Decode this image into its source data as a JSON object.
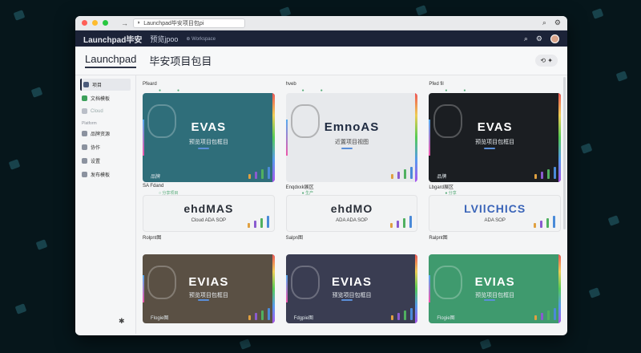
{
  "browser": {
    "url_text": "Launchpad毕安项目包pi",
    "traffic_colors": [
      "#ff5f57",
      "#febc2e",
      "#28c840"
    ]
  },
  "appbar": {
    "brand": "Launchpad毕安",
    "project": "预览jpoo",
    "workspace": "⊕ Workspace"
  },
  "header": {
    "brand": "Launchpad",
    "title": "毕安项目包目",
    "tools": "⟲ ✦"
  },
  "sidebar": {
    "items": [
      {
        "label": "项目",
        "icon": "home-icon",
        "active": true
      },
      {
        "label": "文档模板",
        "icon": "template-icon",
        "active": false
      },
      {
        "label": "Cloud",
        "icon": "cloud-icon",
        "active": false
      }
    ],
    "section_label": "Platform",
    "items2": [
      {
        "label": "品牌资源",
        "icon": "tag-icon"
      },
      {
        "label": "协作",
        "icon": "users-icon"
      },
      {
        "label": "设置",
        "icon": "shield-icon"
      },
      {
        "label": "发布模板",
        "icon": "tray-icon"
      }
    ]
  },
  "cards": [
    {
      "head": "Pfeard",
      "sub_a": "●",
      "sub_b": "●",
      "logo": "EVAS",
      "tagline": "预览项目包框目",
      "foot": "品牌",
      "theme": "teal"
    },
    {
      "head": "hveb",
      "sub_a": "●",
      "sub_b": "●",
      "logo": "EmnoAS",
      "tagline": "近置项目视图",
      "foot": "",
      "theme": "light"
    },
    {
      "head": "Pfed fil",
      "sub_a": "●",
      "sub_b": "●",
      "logo": "EVAS",
      "tagline": "预览项目包框目",
      "foot": "品牌",
      "theme": "dark"
    },
    {
      "head": "SA Fdand",
      "sub_a": "○ 分享项目",
      "sub_b": "",
      "logo": "ehdMAS",
      "tagline": "Cloud ADA SOP",
      "foot": "Rolpnt图",
      "theme": "short1"
    },
    {
      "head": "Enqdxxk展区",
      "sub_a": "● 生产",
      "sub_b": "",
      "logo": "ehdMO",
      "tagline": "ADA ADA SOP",
      "foot": "Salpn图",
      "theme": "short2"
    },
    {
      "head": "Lbgard展区",
      "sub_a": "● 分享",
      "sub_b": "",
      "logo": "LVIlCHICS",
      "tagline": "ADA SOP",
      "foot": "Ralpnt图",
      "theme": "short3"
    },
    {
      "head": "",
      "sub_a": "",
      "sub_b": "",
      "logo": "EVIAS",
      "tagline": "预览项目包框目",
      "foot": "Flogie图",
      "theme": "brown"
    },
    {
      "head": "",
      "sub_a": "",
      "sub_b": "",
      "logo": "EVIAS",
      "tagline": "预览项目包框目",
      "foot": "Fdgpie图",
      "theme": "slate"
    },
    {
      "head": "",
      "sub_a": "",
      "sub_b": "",
      "logo": "EVIAS",
      "tagline": "预览项目包框目",
      "foot": "Flogie图",
      "theme": "green"
    }
  ],
  "themes": {
    "teal": "#2f6e7a",
    "light": "#e7e9ec",
    "dark": "#1b1e22",
    "brown": "#5a5044",
    "slate": "#3a3d52",
    "green": "#3f9a6e"
  }
}
